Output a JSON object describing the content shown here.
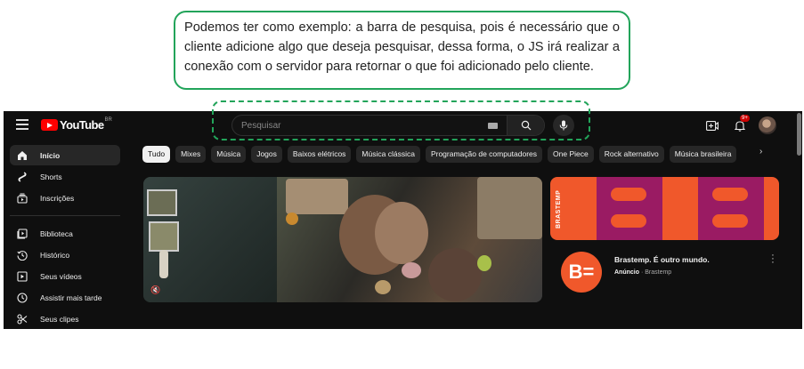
{
  "annotation": {
    "text": "Podemos ter como exemplo: a barra de pesquisa, pois é necessário que o cliente adicione algo que deseja pesquisar, dessa forma, o JS irá realizar a conexão com o servidor para retornar o que foi adicionado pelo cliente."
  },
  "header": {
    "logo_text": "YouTube",
    "logo_region": "BR",
    "search_placeholder": "Pesquisar",
    "notification_count": "9+",
    "icons": [
      "menu-icon",
      "keyboard-icon",
      "search-icon",
      "mic-icon",
      "create-icon",
      "bell-icon"
    ]
  },
  "sidebar": {
    "items": [
      {
        "label": "Início",
        "icon": "home-icon",
        "active": true
      },
      {
        "label": "Shorts",
        "icon": "shorts-icon"
      },
      {
        "label": "Inscrições",
        "icon": "subscriptions-icon"
      },
      {
        "label": "Biblioteca",
        "icon": "library-icon"
      },
      {
        "label": "Histórico",
        "icon": "history-icon"
      },
      {
        "label": "Seus vídeos",
        "icon": "your-videos-icon"
      },
      {
        "label": "Assistir mais tarde",
        "icon": "watch-later-icon"
      },
      {
        "label": "Seus clipes",
        "icon": "clips-icon"
      }
    ]
  },
  "chips": [
    "Tudo",
    "Mixes",
    "Música",
    "Jogos",
    "Baixos elétricos",
    "Música clássica",
    "Programação de computadores",
    "One Piece",
    "Rock alternativo",
    "Música brasileira"
  ],
  "ad": {
    "banner_brand": "BRASTEMP",
    "title": "Brastemp. É outro mundo.",
    "label": "Anúncio",
    "separator": "·",
    "channel": "Brastemp"
  },
  "colors": {
    "annotation_border": "#22a45a",
    "background": "#0f0f0f",
    "brand_red": "#ff0000",
    "ad_orange": "#f0582b",
    "ad_magenta": "#9a1b63"
  }
}
